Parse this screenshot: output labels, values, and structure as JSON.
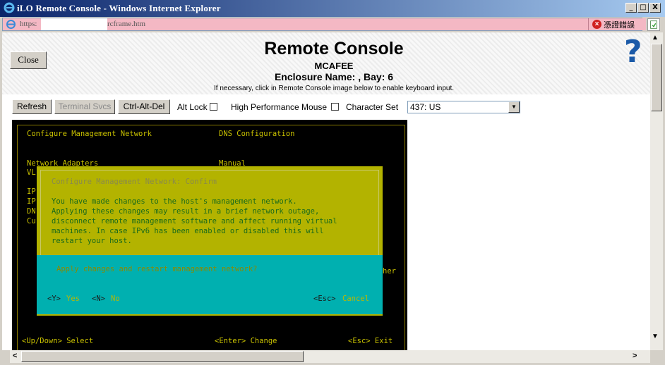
{
  "window": {
    "title": "iLO Remote Console - Windows Internet Explorer",
    "minimize": "_",
    "maximize": "□",
    "close": "X"
  },
  "address": {
    "prefix": "https:",
    "suffix": "rcframe.htm",
    "cert_error": "憑證錯誤"
  },
  "header": {
    "close_label": "Close",
    "title": "Remote Console",
    "host": "MCAFEE",
    "enclosure": "Enclosure Name: , Bay: 6",
    "hint": "If necessary, click in Remote Console image below to enable keyboard input.",
    "help": "?"
  },
  "toolbar": {
    "refresh": "Refresh",
    "terminal_svcs": "Terminal Svcs",
    "ctrl_alt_del": "Ctrl-Alt-Del",
    "alt_lock": "Alt Lock",
    "high_perf_mouse": "High Performance Mouse",
    "character_set": "Character Set",
    "charset_value": "437: US"
  },
  "console": {
    "header_left": "Configure Management Network",
    "header_right": "DNS Configuration",
    "row_label": "Network Adapters",
    "row_value": "Manual",
    "frag_vl": "VL",
    "frag_ip1": "IP",
    "frag_ip2": "IP",
    "frag_dn": "DN",
    "frag_cu": "Cu",
    "frag_her": "her",
    "footer_left": "<Up/Down> Select",
    "footer_mid": "<Enter> Change",
    "footer_right": "<Esc> Exit",
    "dialog": {
      "title": "Configure Management Network: Confirm",
      "line1": "You have made changes to the host's management network.",
      "line2": "Applying these changes may result in a brief network outage,",
      "line3": "disconnect remote management software and affect running virtual",
      "line4": "machines. In case IPv6 has been enabled or disabled this will",
      "line5": "restart your host.",
      "question": "Apply changes and restart management network?",
      "yes_key": "<Y>",
      "yes": "Yes",
      "no_key": "<N>",
      "no": "No",
      "esc_key": "<Esc>",
      "cancel": "Cancel"
    }
  }
}
